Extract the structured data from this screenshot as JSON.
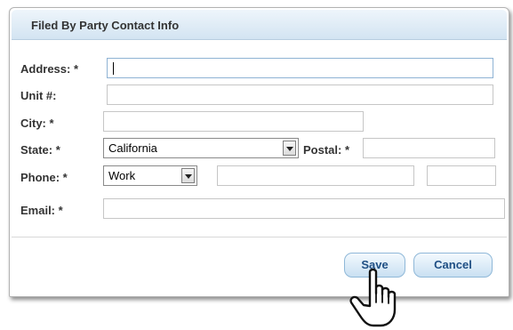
{
  "panel": {
    "title": "Filed By Party Contact Info"
  },
  "form": {
    "address": {
      "label": "Address: *",
      "value": ""
    },
    "unit": {
      "label": "Unit #:",
      "value": ""
    },
    "city": {
      "label": "City: *",
      "value": ""
    },
    "state": {
      "label": "State: *",
      "selected": "California"
    },
    "postal": {
      "label": "Postal: *",
      "value": ""
    },
    "phone": {
      "label": "Phone: *",
      "type_selected": "Work",
      "number_value": "",
      "ext_value": ""
    },
    "email": {
      "label": "Email: *",
      "value": ""
    }
  },
  "buttons": {
    "save": "Save",
    "cancel": "Cancel"
  },
  "icons": {
    "cursor": "hand-pointer-icon",
    "dropdown": "chevron-down-icon"
  },
  "colors": {
    "header_bg": "#d3e4f2",
    "button_text": "#1f4f84",
    "button_border": "#8fb8d8"
  }
}
